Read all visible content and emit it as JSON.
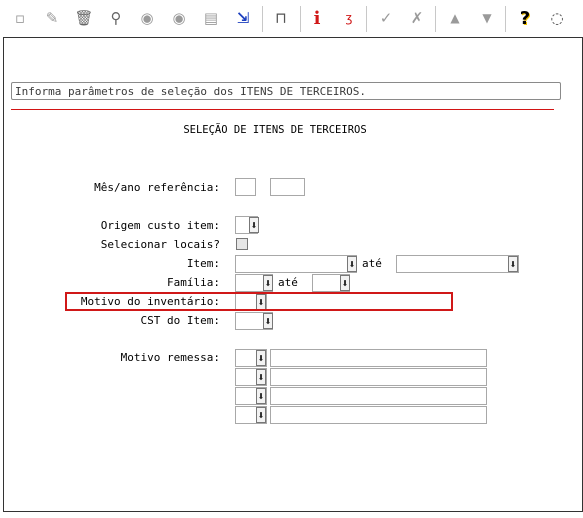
{
  "toolbar": {
    "items": [
      {
        "name": "new-icon",
        "glyph": "▫"
      },
      {
        "name": "edit-icon",
        "glyph": "✎"
      },
      {
        "name": "delete-icon",
        "glyph": "🗑"
      },
      {
        "name": "search-icon",
        "glyph": "⚲"
      },
      {
        "name": "previous-icon",
        "glyph": "◉"
      },
      {
        "name": "next-icon",
        "glyph": "◉"
      },
      {
        "name": "print-icon",
        "glyph": "▤"
      },
      {
        "name": "goto-icon",
        "glyph": "⇲"
      },
      {
        "name": "filter-icon",
        "glyph": "⊓"
      },
      {
        "name": "info-icon",
        "glyph": "i"
      },
      {
        "name": "query-icon",
        "glyph": "ʒ"
      },
      {
        "name": "confirm-icon",
        "glyph": "✓"
      },
      {
        "name": "cancel-icon",
        "glyph": "✗"
      },
      {
        "name": "up-icon",
        "glyph": "▲"
      },
      {
        "name": "down-icon",
        "glyph": "▼"
      },
      {
        "name": "help-icon",
        "glyph": "?"
      },
      {
        "name": "chat-icon",
        "glyph": "◌"
      }
    ],
    "accent_red": "#d01818",
    "accent_blue": "#1c3fbf",
    "accent_yellow": "#f2c200"
  },
  "info_text": "Informa parâmetros de seleção dos ITENS DE TERCEIROS.",
  "section_title": "SELEÇÃO DE ITENS DE TERCEIROS",
  "fields": {
    "mes_ano": "Mês/ano referência:",
    "origem": "Origem custo item:",
    "selecionar": "Selecionar locais?",
    "item": "Item:",
    "familia": "Família:",
    "motivo_inv": "Motivo do inventário:",
    "cst": "CST do Item:",
    "motivo_rem": "Motivo remessa:",
    "ate": "até"
  },
  "dropdown_glyph": "⬇"
}
